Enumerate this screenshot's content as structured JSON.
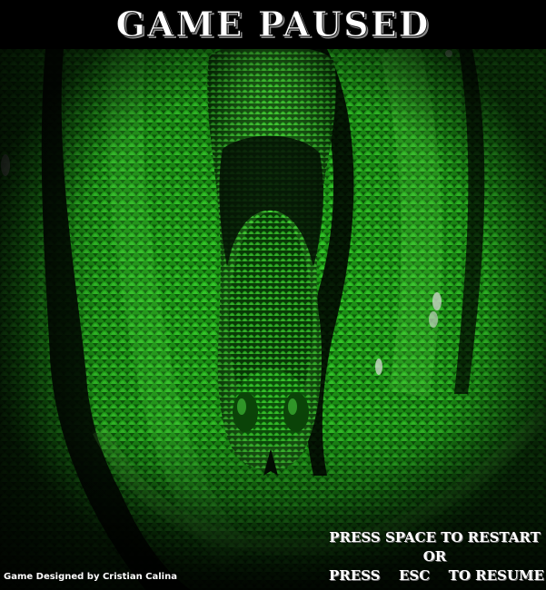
{
  "title": "GAME PAUSED",
  "credit": "Game Designed by Cristian Calina",
  "instructions": {
    "restart": "PRESS SPACE TO RESTART",
    "or": "OR",
    "press": "PRESS",
    "key": "ESC",
    "resume": "TO RESUME"
  },
  "background": {
    "subject": "green-snake-scales",
    "colors": {
      "primary": "#22c41a",
      "highlight": "#6dff55",
      "dark": "#062a05",
      "bar": "#000000"
    }
  }
}
